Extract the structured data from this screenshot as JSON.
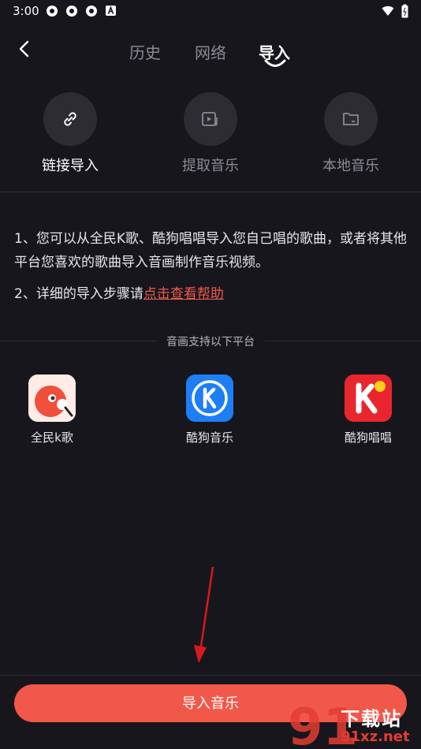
{
  "status_bar": {
    "time": "3:00"
  },
  "nav": {
    "tabs": [
      {
        "label": "历史",
        "active": false
      },
      {
        "label": "网络",
        "active": false
      },
      {
        "label": "导入",
        "active": true
      }
    ]
  },
  "modes": [
    {
      "label": "链接导入",
      "icon": "link-icon",
      "active": true
    },
    {
      "label": "提取音乐",
      "icon": "video-music-icon",
      "active": false
    },
    {
      "label": "本地音乐",
      "icon": "folder-icon",
      "active": false
    }
  ],
  "description": {
    "line1": "1、您可以从全民K歌、酷狗唱唱导入您自己唱的歌曲，或者将其他平台您喜欢的歌曲导入音画制作音乐视频。",
    "line2_prefix": "2、详细的导入步骤请",
    "line2_link": "点击查看帮助"
  },
  "support": {
    "title": "音画支持以下平台",
    "platforms": [
      {
        "label": "全民k歌",
        "icon": "quanmin-kge-logo-icon"
      },
      {
        "label": "酷狗音乐",
        "icon": "kugou-music-logo-icon"
      },
      {
        "label": "酷狗唱唱",
        "icon": "kugou-changchang-logo-icon"
      }
    ]
  },
  "import_button": {
    "label": "导入音乐"
  },
  "watermark": {
    "text1": "下载站",
    "text2": "91xz.net",
    "logo_text": "91"
  },
  "colors": {
    "accent": "#f2584a",
    "background": "#17161c",
    "link": "#ef5b4e"
  }
}
